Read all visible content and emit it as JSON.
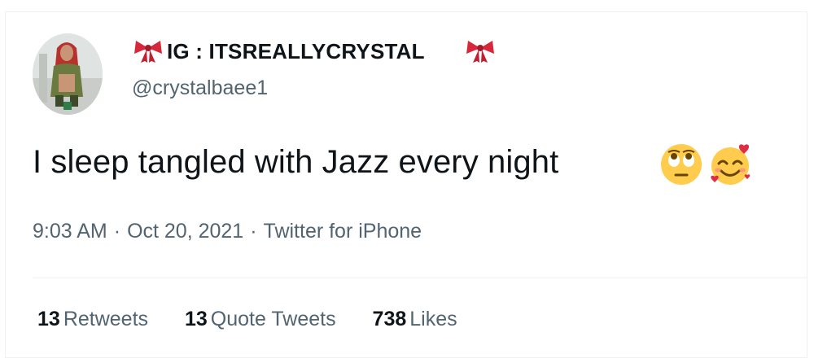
{
  "user": {
    "display_name": "IG : ITSREALLYCRYSTAL",
    "handle": "@crystalbaee1",
    "avatar_icon": "profile-photo-avatar",
    "name_decoration_icon": "ribbon-bow-icon",
    "bow_color": "#d6283a"
  },
  "tweet": {
    "text": "I sleep tangled with Jazz every night",
    "emojis": [
      "face-with-rolling-eyes-emoji",
      "smiling-face-with-hearts-emoji"
    ]
  },
  "meta": {
    "time": "9:03 AM",
    "separator": "·",
    "date": "Oct 20, 2021",
    "source": "Twitter for iPhone"
  },
  "stats": {
    "retweets": {
      "count": "13",
      "label": "Retweets"
    },
    "quote_tweets": {
      "count": "13",
      "label": "Quote Tweets"
    },
    "likes": {
      "count": "738",
      "label": "Likes"
    }
  },
  "colors": {
    "text_primary": "#0f1419",
    "text_secondary": "#536471",
    "divider": "#eff3f4",
    "emoji_yellow": "#ffcc4d",
    "heart_red": "#dd2e44"
  }
}
